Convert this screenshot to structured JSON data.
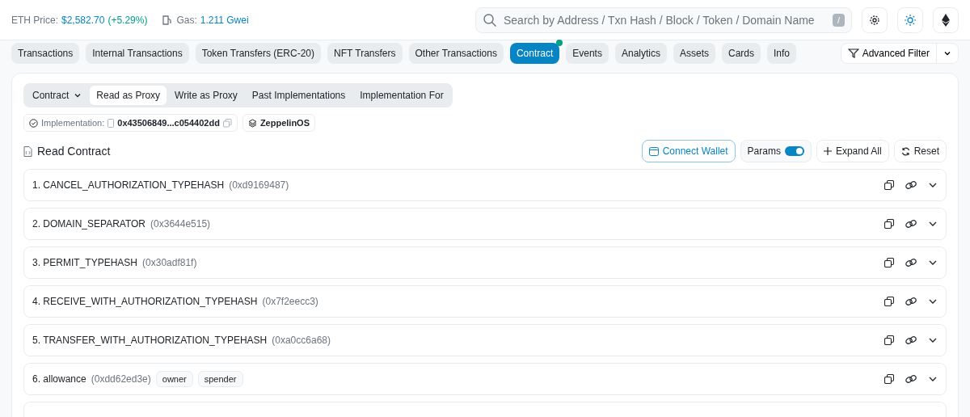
{
  "header": {
    "price_label": "ETH Price:",
    "price_value": "$2,582.70",
    "price_change": "(+5.29%)",
    "gas_label": "Gas:",
    "gas_value": "1.211 Gwei",
    "search": {
      "placeholder": "Search by Address / Txn Hash / Block / Token / Domain Name",
      "shortcut": "/"
    }
  },
  "tabs": [
    {
      "label": "Transactions",
      "selected": false,
      "badge": false
    },
    {
      "label": "Internal Transactions",
      "selected": false,
      "badge": false
    },
    {
      "label": "Token Transfers (ERC-20)",
      "selected": false,
      "badge": false
    },
    {
      "label": "NFT Transfers",
      "selected": false,
      "badge": false
    },
    {
      "label": "Other Transactions",
      "selected": false,
      "badge": false
    },
    {
      "label": "Contract",
      "selected": true,
      "badge": true
    },
    {
      "label": "Events",
      "selected": false,
      "badge": false
    },
    {
      "label": "Analytics",
      "selected": false,
      "badge": false
    },
    {
      "label": "Assets",
      "selected": false,
      "badge": false
    },
    {
      "label": "Cards",
      "selected": false,
      "badge": false
    },
    {
      "label": "Info",
      "selected": false,
      "badge": false
    }
  ],
  "advanced_filter": "Advanced Filter",
  "subtabs": [
    {
      "label": "Contract",
      "selected": false,
      "dropdown": true
    },
    {
      "label": "Read as Proxy",
      "selected": true,
      "dropdown": false
    },
    {
      "label": "Write as Proxy",
      "selected": false,
      "dropdown": false
    },
    {
      "label": "Past Implementations",
      "selected": false,
      "dropdown": false
    },
    {
      "label": "Implementation For",
      "selected": false,
      "dropdown": false
    }
  ],
  "implementation": {
    "label": "Implementation:",
    "address": "0x43506849...c054402dd",
    "framework": "ZeppelinOS"
  },
  "section_title": "Read Contract",
  "actions": {
    "connect": "Connect Wallet",
    "params": "Params",
    "params_on": true,
    "expand": "Expand All",
    "reset": "Reset"
  },
  "functions": [
    {
      "name": "1. CANCEL_AUTHORIZATION_TYPEHASH",
      "selector": "(0xd9169487)"
    },
    {
      "name": "2. DOMAIN_SEPARATOR",
      "selector": "(0x3644e515)"
    },
    {
      "name": "3. PERMIT_TYPEHASH",
      "selector": "(0x30adf81f)"
    },
    {
      "name": "4. RECEIVE_WITH_AUTHORIZATION_TYPEHASH",
      "selector": "(0x7f2eecc3)"
    },
    {
      "name": "5. TRANSFER_WITH_AUTHORIZATION_TYPEHASH",
      "selector": "(0xa0cc6a68)"
    },
    {
      "name": "6. allowance",
      "selector": "(0xdd62ed3e)",
      "params": [
        "owner",
        "spender"
      ]
    }
  ]
}
